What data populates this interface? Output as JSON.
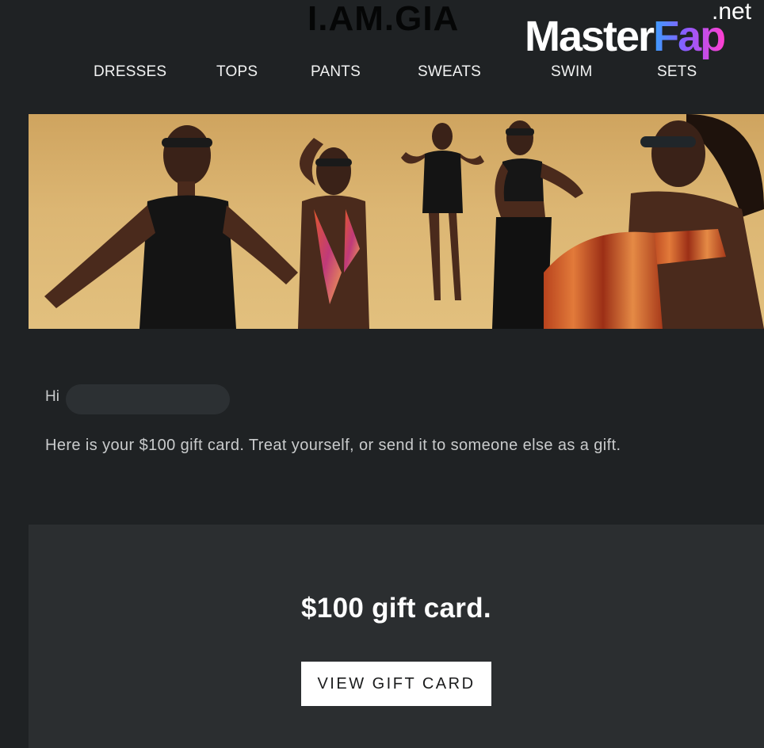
{
  "brand": {
    "logo_text": "I.AM.GIA"
  },
  "watermark": {
    "master": "Master",
    "fap": "Fap",
    "net": ".net"
  },
  "nav": {
    "items": [
      {
        "label": "DRESSES"
      },
      {
        "label": "TOPS"
      },
      {
        "label": "PANTS"
      },
      {
        "label": "SWEATS"
      },
      {
        "label": "SWIM"
      },
      {
        "label": "SETS"
      }
    ]
  },
  "email": {
    "greeting": "Hi",
    "message": "Here is your $100 gift card. Treat yourself, or send it to someone else as a gift."
  },
  "gift": {
    "title": "$100 gift card.",
    "button_label": "VIEW GIFT CARD"
  },
  "colors": {
    "background": "#1f2224",
    "panel": "#2b2e30",
    "button_bg": "#ffffff",
    "hero_backdrop": "#dcb673"
  }
}
